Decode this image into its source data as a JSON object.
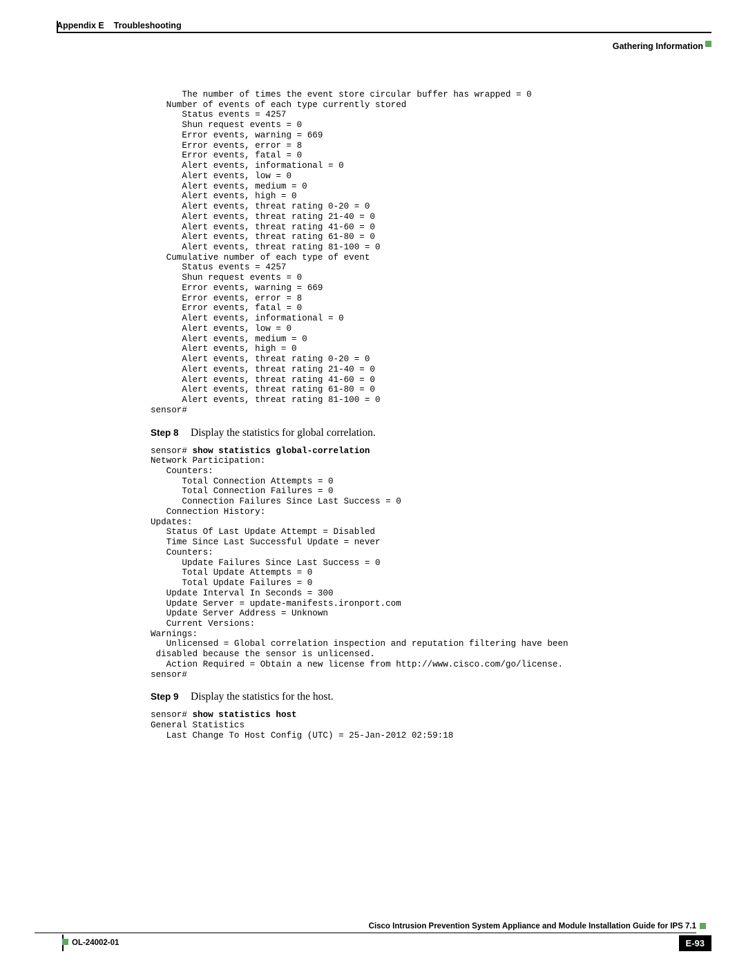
{
  "header": {
    "appendix": "Appendix E",
    "title": "Troubleshooting",
    "section": "Gathering Information"
  },
  "code_block_1": "      The number of times the event store circular buffer has wrapped = 0\n   Number of events of each type currently stored\n      Status events = 4257\n      Shun request events = 0\n      Error events, warning = 669\n      Error events, error = 8\n      Error events, fatal = 0\n      Alert events, informational = 0\n      Alert events, low = 0\n      Alert events, medium = 0\n      Alert events, high = 0\n      Alert events, threat rating 0-20 = 0\n      Alert events, threat rating 21-40 = 0\n      Alert events, threat rating 41-60 = 0\n      Alert events, threat rating 61-80 = 0\n      Alert events, threat rating 81-100 = 0\n   Cumulative number of each type of event\n      Status events = 4257\n      Shun request events = 0\n      Error events, warning = 669\n      Error events, error = 8\n      Error events, fatal = 0\n      Alert events, informational = 0\n      Alert events, low = 0\n      Alert events, medium = 0\n      Alert events, high = 0\n      Alert events, threat rating 0-20 = 0\n      Alert events, threat rating 21-40 = 0\n      Alert events, threat rating 41-60 = 0\n      Alert events, threat rating 61-80 = 0\n      Alert events, threat rating 81-100 = 0\nsensor#",
  "step8": {
    "label": "Step 8",
    "text": "Display the statistics for global correlation."
  },
  "code_block_2_prompt": "sensor# ",
  "code_block_2_cmd": "show statistics global-correlation",
  "code_block_2_body": "Network Participation:\n   Counters:\n      Total Connection Attempts = 0\n      Total Connection Failures = 0\n      Connection Failures Since Last Success = 0\n   Connection History:\nUpdates:\n   Status Of Last Update Attempt = Disabled\n   Time Since Last Successful Update = never\n   Counters:\n      Update Failures Since Last Success = 0\n      Total Update Attempts = 0\n      Total Update Failures = 0\n   Update Interval In Seconds = 300\n   Update Server = update-manifests.ironport.com\n   Update Server Address = Unknown\n   Current Versions:\nWarnings:\n   Unlicensed = Global correlation inspection and reputation filtering have been \n disabled because the sensor is unlicensed.\n   Action Required = Obtain a new license from http://www.cisco.com/go/license.\nsensor#",
  "step9": {
    "label": "Step 9",
    "text": "Display the statistics for the host."
  },
  "code_block_3_prompt": "sensor# ",
  "code_block_3_cmd": "show statistics host",
  "code_block_3_body": "General Statistics\n   Last Change To Host Config (UTC) = 25-Jan-2012 02:59:18",
  "footer": {
    "guide": "Cisco Intrusion Prevention System Appliance and Module Installation Guide for IPS 7.1",
    "docnum": "OL-24002-01",
    "pagenum": "E-93"
  }
}
